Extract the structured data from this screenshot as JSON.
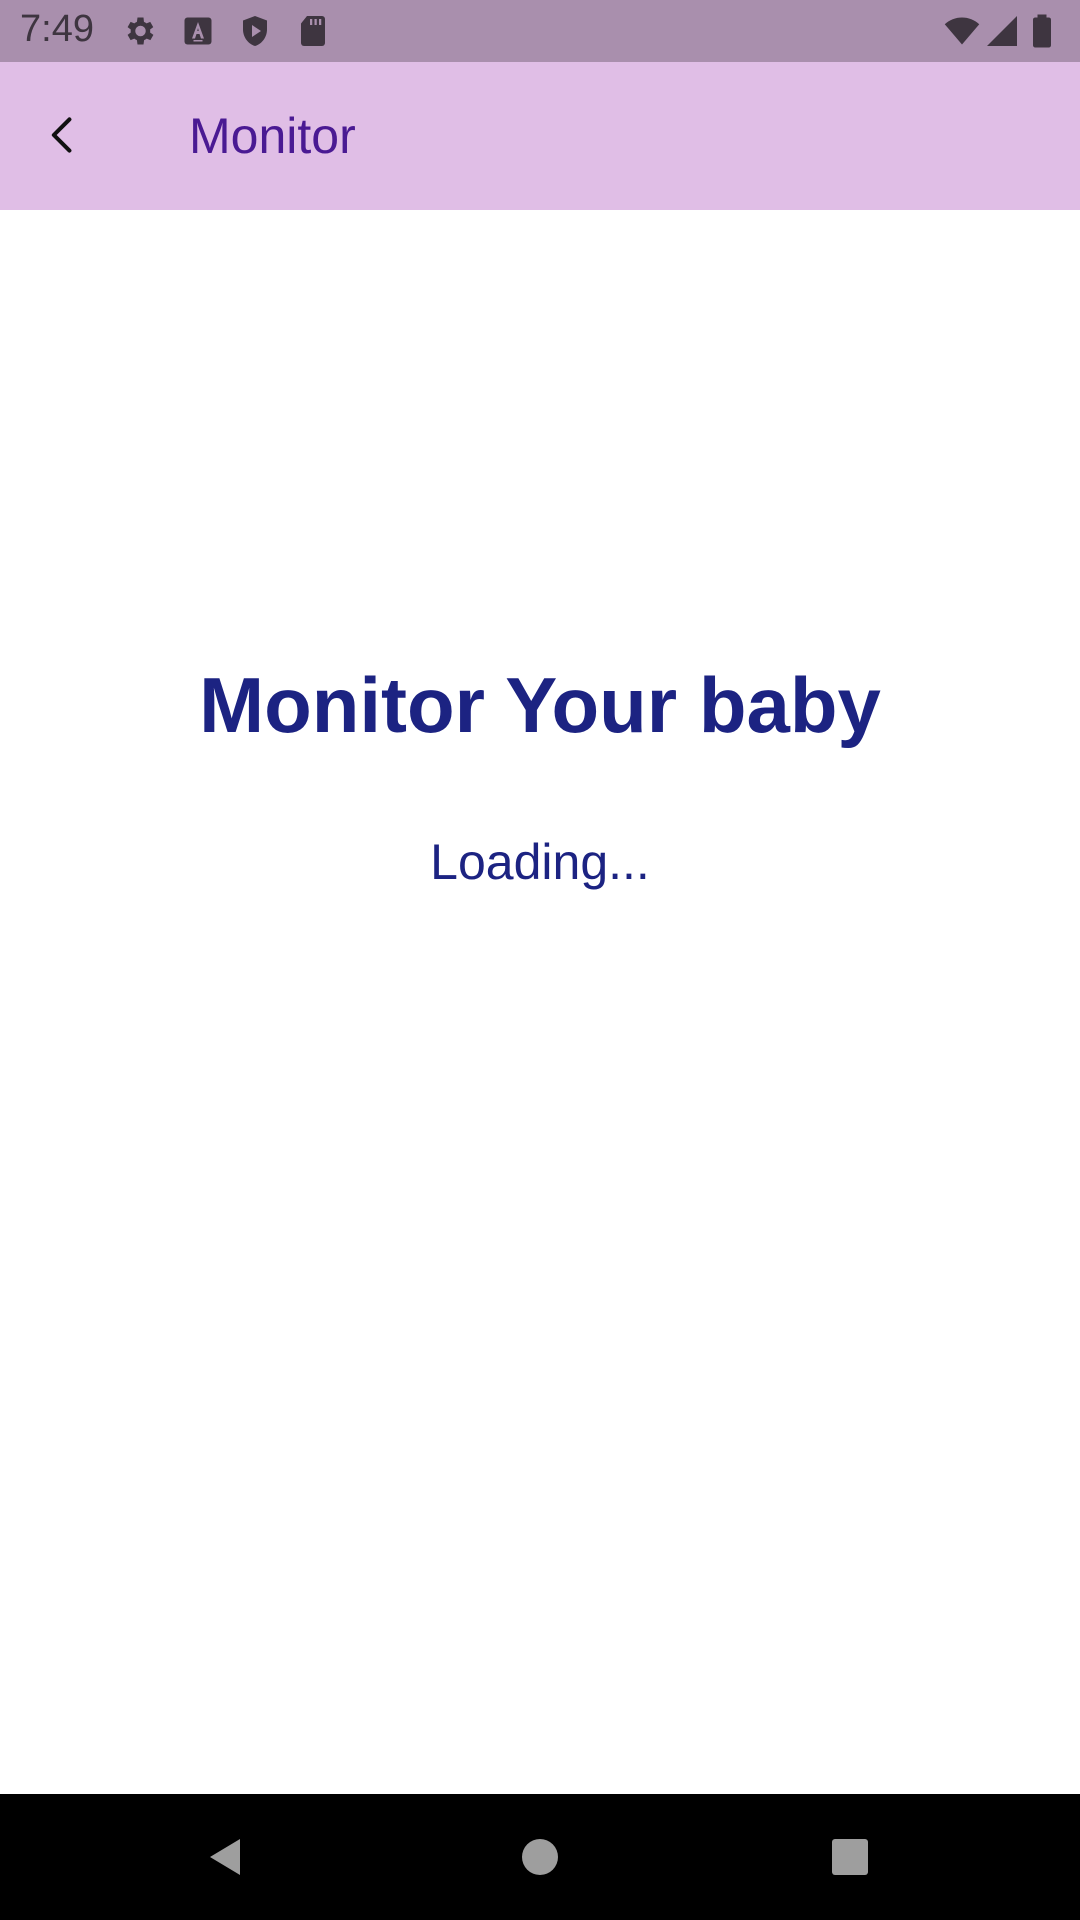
{
  "status_bar": {
    "time": "7:49",
    "left_icons": [
      "settings-icon",
      "text-a-icon",
      "play-protect-icon",
      "sd-card-icon"
    ],
    "right_icons": [
      "wifi-icon",
      "cell-signal-icon",
      "battery-icon"
    ]
  },
  "app_bar": {
    "back_icon": "back-arrow-icon",
    "title": "Monitor"
  },
  "main": {
    "heading": "Monitor Your baby",
    "status_text": "Loading..."
  },
  "nav_bar": {
    "buttons": [
      "back-triangle-icon",
      "home-circle-icon",
      "recents-square-icon"
    ]
  },
  "colors": {
    "status_bar_bg": "#a98fad",
    "app_bar_bg": "#e0bee6",
    "app_title": "#4a1a93",
    "heading": "#1c2382",
    "nav_bar_bg": "#000000"
  }
}
